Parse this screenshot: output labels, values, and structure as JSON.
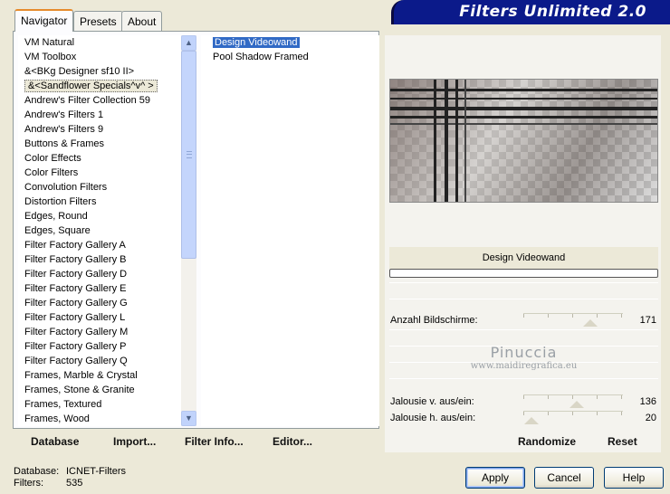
{
  "window": {
    "title": "Filters Unlimited 2.0"
  },
  "tabs": [
    {
      "label": "Navigator",
      "active": true
    },
    {
      "label": "Presets",
      "active": false
    },
    {
      "label": "About",
      "active": false
    }
  ],
  "categories": {
    "items": [
      "VM Natural",
      "VM Toolbox",
      "&<BKg Designer sf10 II>",
      "&<Sandflower Specials^v^ >",
      "Andrew's Filter Collection 59",
      "Andrew's Filters 1",
      "Andrew's Filters 9",
      "Buttons & Frames",
      "Color Effects",
      "Color Filters",
      "Convolution Filters",
      "Distortion Filters",
      "Edges, Round",
      "Edges, Square",
      "Filter Factory Gallery A",
      "Filter Factory Gallery B",
      "Filter Factory Gallery D",
      "Filter Factory Gallery E",
      "Filter Factory Gallery G",
      "Filter Factory Gallery L",
      "Filter Factory Gallery M",
      "Filter Factory Gallery P",
      "Filter Factory Gallery Q",
      "Frames, Marble & Crystal",
      "Frames, Stone & Granite",
      "Frames, Textured",
      "Frames, Wood"
    ],
    "selected_index": 3
  },
  "filters": {
    "items": [
      "Design Videowand",
      "Pool Shadow Framed"
    ],
    "selected_index": 0
  },
  "left_buttons": {
    "database": "Database",
    "import": "Import...",
    "filter_info": "Filter Info...",
    "editor": "Editor..."
  },
  "preview": {
    "filter_name": "Design Videowand"
  },
  "params": [
    {
      "label": "Anzahl Bildschirme:",
      "value": "171",
      "level": 0.671
    },
    {
      "label": "Jalousie v. aus/ein:",
      "value": "136",
      "level": 0.533
    },
    {
      "label": "Jalousie h. aus/ein:",
      "value": "20",
      "level": 0.078
    }
  ],
  "watermark": {
    "name": "Pinuccia",
    "url": "www.maidiregrafica.eu"
  },
  "right_buttons": {
    "randomize": "Randomize",
    "reset": "Reset"
  },
  "status": {
    "database_label": "Database:",
    "database_value": "ICNET-Filters",
    "filters_label": "Filters:",
    "filters_value": "535"
  },
  "dialog_buttons": {
    "apply": "Apply",
    "cancel": "Cancel",
    "help": "Help"
  }
}
